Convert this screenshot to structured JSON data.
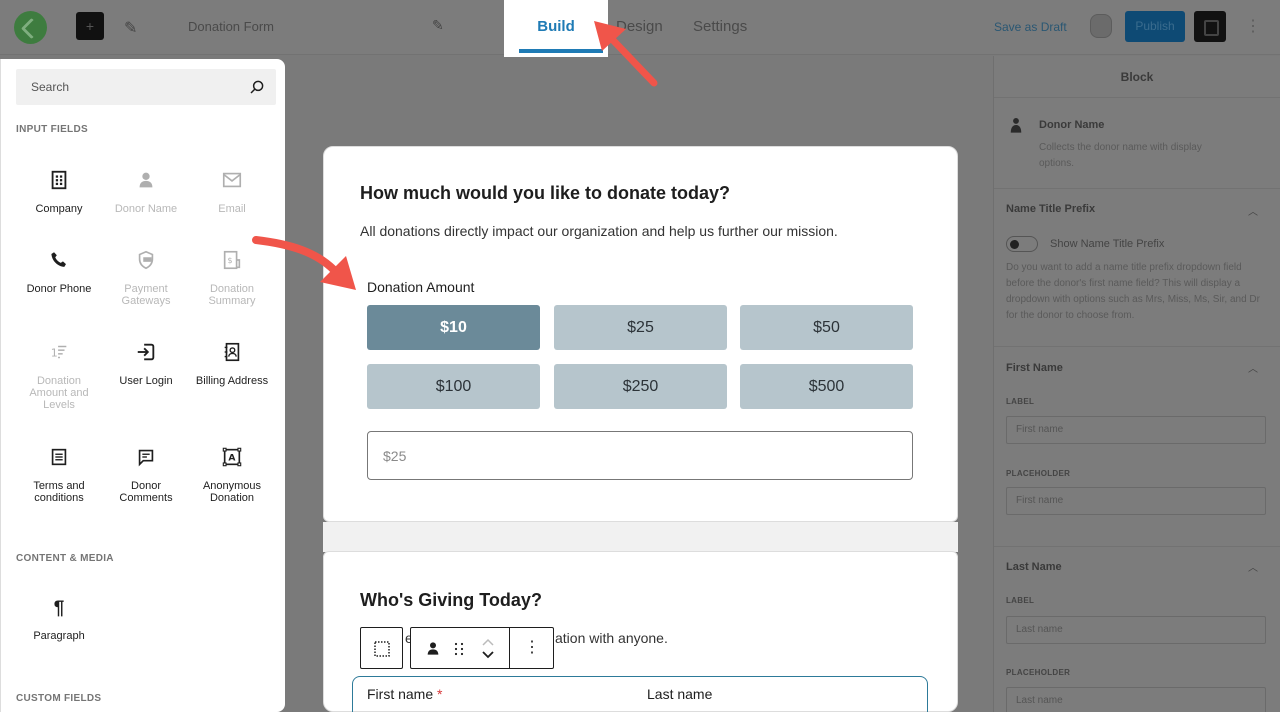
{
  "topbar": {
    "document_title": "Donation Form",
    "tabs": [
      {
        "label": "Build",
        "active": true
      },
      {
        "label": "Design",
        "active": false
      },
      {
        "label": "Settings",
        "active": false
      }
    ],
    "save_draft_label": "Save as Draft",
    "publish_label": "Publish",
    "accent_color": "#1f7bb5"
  },
  "inserter": {
    "search_placeholder": "Search",
    "sections": [
      {
        "title": "INPUT FIELDS",
        "blocks": [
          {
            "label": "Company",
            "icon": "building-icon",
            "disabled": false
          },
          {
            "label": "Donor Name",
            "icon": "person-icon",
            "disabled": true
          },
          {
            "label": "Email",
            "icon": "envelope-icon",
            "disabled": true
          },
          {
            "label": "Donor Phone",
            "icon": "phone-icon",
            "disabled": false
          },
          {
            "label": "Payment Gateways",
            "icon": "shield-card-icon",
            "disabled": true
          },
          {
            "label": "Donation Summary",
            "icon": "receipt-dollar-icon",
            "disabled": true
          },
          {
            "label": "Donation Amount and Levels",
            "icon": "number-list-icon",
            "disabled": true
          },
          {
            "label": "User Login",
            "icon": "login-arrow-icon",
            "disabled": false
          },
          {
            "label": "Billing Address",
            "icon": "address-book-icon",
            "disabled": false
          },
          {
            "label": "Terms and conditions",
            "icon": "document-list-icon",
            "disabled": false
          },
          {
            "label": "Donor Comments",
            "icon": "comment-icon",
            "disabled": false
          },
          {
            "label": "Anonymous Donation",
            "icon": "text-frame-icon",
            "disabled": false
          }
        ]
      },
      {
        "title": "CONTENT & MEDIA",
        "blocks": [
          {
            "label": "Paragraph",
            "icon": "pilcrow-icon",
            "disabled": false
          }
        ]
      },
      {
        "title": "CUSTOM FIELDS",
        "blocks": []
      }
    ]
  },
  "form": {
    "amount_section": {
      "heading": "How much would you like to donate today?",
      "description": "All donations directly impact our organization and help us further our mission.",
      "amount_label": "Donation Amount",
      "levels": [
        "$10",
        "$25",
        "$50",
        "$100",
        "$250",
        "$500"
      ],
      "selected_level": "$10",
      "custom_amount_value": "$25",
      "selected_color": "#6b8a99",
      "level_color": "#b6c5cc"
    },
    "donor_section": {
      "heading": "Who's Giving Today?",
      "description_visible_start": "e",
      "description_visible_end": "ation with anyone.",
      "first_name_label": "First name",
      "required_marker": "*",
      "last_name_label": "Last name"
    }
  },
  "block_toolbar": {
    "parent_icon": "select-parent-icon",
    "block_icon": "person-icon",
    "more_label": "⋮"
  },
  "settings_panel": {
    "tab_label": "Block",
    "block_title": "Donor Name",
    "block_description": "Collects the donor name with display options.",
    "sections": [
      {
        "title": "Name Title Prefix",
        "toggle_label": "Show Name Title Prefix",
        "toggle_on": false,
        "help": "Do you want to add a name title prefix dropdown field before the donor's first name field? This will display a dropdown with options such as Mrs, Miss, Ms, Sir, and Dr for the donor to choose from."
      },
      {
        "title": "First Name",
        "label_caption": "LABEL",
        "label_value": "First name",
        "placeholder_caption": "PLACEHOLDER",
        "placeholder_value": "First name"
      },
      {
        "title": "Last Name",
        "label_caption": "LABEL",
        "label_value": "Last name",
        "placeholder_caption": "PLACEHOLDER",
        "placeholder_value": "Last name"
      }
    ]
  },
  "annotations": {
    "arrow_color": "#f0554a"
  }
}
